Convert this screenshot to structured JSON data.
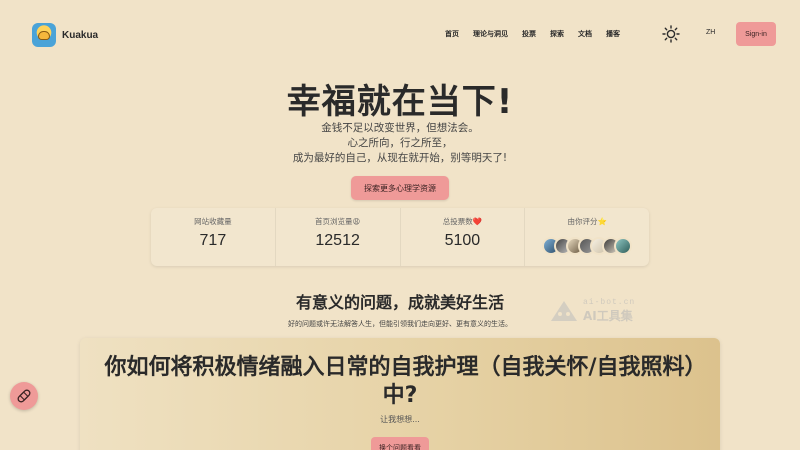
{
  "header": {
    "brand": "Kuakua",
    "nav": [
      "首页",
      "理论与洞见",
      "投票",
      "探索",
      "文档",
      "播客"
    ],
    "lang": "ZH",
    "signin": "Sign-in"
  },
  "hero": {
    "title": "幸福就在当下!",
    "lines": [
      "金钱不足以改变世界，但想法会。",
      "心之所向，行之所至，",
      "成为最好的自己，从现在就开始，别等明天了!"
    ],
    "cta": "探索更多心理学资源"
  },
  "stats": [
    {
      "label": "网站收藏量",
      "value": "717"
    },
    {
      "label": "首页浏览量😩",
      "value": "12512"
    },
    {
      "label": "总投票数❤️",
      "value": "5100"
    },
    {
      "label": "由你评分⭐"
    }
  ],
  "section": {
    "title": "有意义的问题，成就美好生活",
    "subtitle": "好的问题或许无法解答人生，但能引领我们走向更好、更有意义的生活。"
  },
  "watermark": {
    "url": "ai-bot.cn",
    "name": "AI工具集"
  },
  "card": {
    "title": "你如何将积极情绪融入日常的自我护理（自我关怀/自我照料）中?",
    "subtitle": "让我想想...",
    "button": "换个问题看看"
  },
  "colors": {
    "background": "#f1e3c8",
    "accent": "#ef9a98"
  },
  "icons": {
    "theme": "sun-icon",
    "fab": "bandage-icon"
  }
}
